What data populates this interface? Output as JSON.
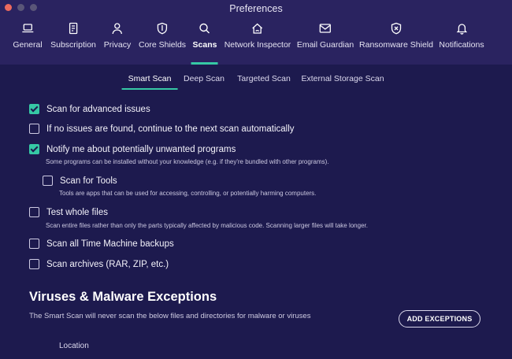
{
  "window": {
    "title": "Preferences"
  },
  "toolbar": {
    "items": [
      {
        "label": "General",
        "icon": "laptop-icon",
        "active": false
      },
      {
        "label": "Subscription",
        "icon": "document-icon",
        "active": false
      },
      {
        "label": "Privacy",
        "icon": "person-icon",
        "active": false
      },
      {
        "label": "Core Shields",
        "icon": "shield-icon",
        "active": false
      },
      {
        "label": "Scans",
        "icon": "magnifier-icon",
        "active": true
      },
      {
        "label": "Network Inspector",
        "icon": "home-wifi-icon",
        "active": false
      },
      {
        "label": "Email Guardian",
        "icon": "envelope-icon",
        "active": false
      },
      {
        "label": "Ransomware Shield",
        "icon": "shield-x-icon",
        "active": false
      },
      {
        "label": "Notifications",
        "icon": "bell-icon",
        "active": false
      }
    ]
  },
  "subtabs": [
    "Smart Scan",
    "Deep Scan",
    "Targeted Scan",
    "External Storage Scan"
  ],
  "active_subtab": "Smart Scan",
  "options": {
    "advanced_issues": {
      "label": "Scan for advanced issues",
      "checked": true
    },
    "continue_next": {
      "label": "If no issues are found, continue to the next scan automatically",
      "checked": false
    },
    "pup": {
      "label": "Notify me about potentially unwanted programs",
      "checked": true,
      "hint": "Some programs can be installed without your knowledge (e.g. if they're bundled with other programs)."
    },
    "tools": {
      "label": "Scan for Tools",
      "checked": false,
      "hint": "Tools are apps that can be used for accessing, controlling, or potentially harming computers."
    },
    "whole_files": {
      "label": "Test whole files",
      "checked": false,
      "hint": "Scan entire files rather than only the parts typically affected by malicious code. Scanning larger files will take longer."
    },
    "time_machine": {
      "label": "Scan all Time Machine backups",
      "checked": false
    },
    "archives": {
      "label": "Scan archives (RAR, ZIP, etc.)",
      "checked": false
    }
  },
  "exceptions": {
    "title": "Viruses & Malware Exceptions",
    "description": "The Smart Scan will never scan the below files and directories for malware or viruses",
    "button": "ADD EXCEPTIONS",
    "column_location": "Location"
  },
  "colors": {
    "background": "#1d1a4e",
    "toolbar": "#2a2360",
    "accent": "#36c8a5"
  }
}
